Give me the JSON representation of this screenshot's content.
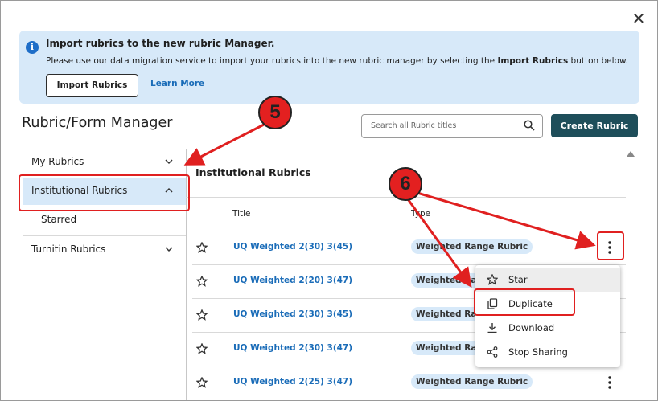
{
  "banner": {
    "title": "Import rubrics to the new rubric Manager.",
    "desc_prefix": "Please use our data migration service to import your rubrics into the new rubric manager by selecting the ",
    "desc_bold": "Import Rubrics",
    "desc_suffix": " button below.",
    "import_label": "Import Rubrics",
    "learn_label": "Learn More"
  },
  "page": {
    "title": "Rubric/Form Manager",
    "search_placeholder": "Search all Rubric titles",
    "create_label": "Create Rubric"
  },
  "sidebar": {
    "items": [
      {
        "label": "My Rubrics"
      },
      {
        "label": "Institutional Rubrics"
      },
      {
        "label": "Starred"
      },
      {
        "label": "Turnitin Rubrics"
      }
    ]
  },
  "main": {
    "title": "Institutional Rubrics",
    "col_title": "Title",
    "col_type": "Type",
    "rows": [
      {
        "name": "UQ Weighted 2(30) 3(45)",
        "type": "Weighted Range Rubric"
      },
      {
        "name": "UQ Weighted 2(20) 3(47)",
        "type": "Weighted Range Rubric"
      },
      {
        "name": "UQ Weighted 2(30) 3(45)",
        "type": "Weighted Range Rubric"
      },
      {
        "name": "UQ Weighted 2(30) 3(47)",
        "type": "Weighted Range Rubric"
      },
      {
        "name": "UQ Weighted 2(25) 3(47)",
        "type": "Weighted Range Rubric"
      }
    ]
  },
  "menu": {
    "items": [
      {
        "label": "Star"
      },
      {
        "label": "Duplicate"
      },
      {
        "label": "Download"
      },
      {
        "label": "Stop Sharing"
      }
    ]
  },
  "callouts": [
    "5",
    "6"
  ],
  "colors": {
    "accent": "#1e4e5a",
    "link": "#1a6cb8",
    "highlight": "#e02020",
    "banner_bg": "#d7e9f9"
  }
}
